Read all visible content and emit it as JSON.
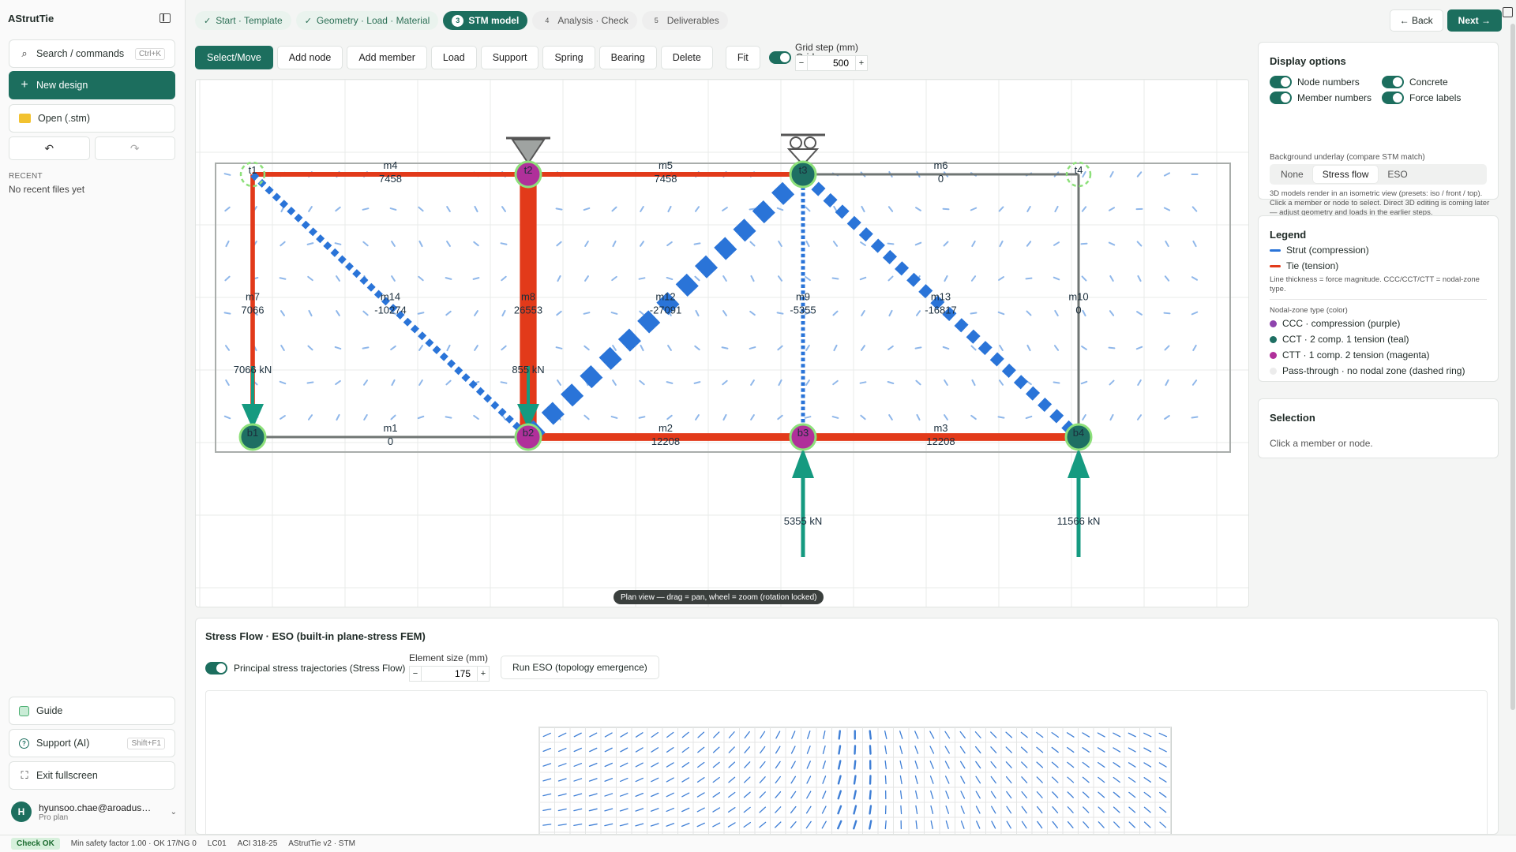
{
  "app": {
    "title": "AStrutTie"
  },
  "sidebar": {
    "search_label": "Search / commands",
    "search_kbd": "Ctrl+K",
    "new_design": "New design",
    "open": "Open (.stm)",
    "recent_heading": "RECENT",
    "recent_empty": "No recent files yet",
    "guide": "Guide",
    "support": "Support (AI)",
    "support_kbd": "Shift+F1",
    "exit_fullscreen": "Exit fullscreen",
    "user_initial": "H",
    "user_email": "hyunsoo.chae@aroadus…",
    "user_plan": "Pro plan"
  },
  "steps": [
    {
      "num": "✓",
      "label": "Start · Template",
      "state": "done"
    },
    {
      "num": "✓",
      "label": "Geometry · Load · Material",
      "state": "done"
    },
    {
      "num": "3",
      "label": "STM model",
      "state": "active"
    },
    {
      "num": "4",
      "label": "Analysis · Check",
      "state": "todo"
    },
    {
      "num": "5",
      "label": "Deliverables",
      "state": "todo"
    }
  ],
  "nav": {
    "back": "← Back",
    "next": "Next →"
  },
  "toolbar": {
    "tools": [
      "Select/Move",
      "Add node",
      "Add member",
      "Load",
      "Support",
      "Spring",
      "Bearing",
      "Delete"
    ],
    "fit": "Fit",
    "grid": "Grid",
    "grid_step_label": "Grid step (mm)",
    "grid_step_value": "500"
  },
  "canvas": {
    "hint": "Plan view — drag = pan, wheel = zoom (rotation locked)",
    "nodes": [
      {
        "id": "t1",
        "zone": "pass"
      },
      {
        "id": "t2",
        "zone": "CTT"
      },
      {
        "id": "t3",
        "zone": "CCT"
      },
      {
        "id": "t4",
        "zone": "pass"
      },
      {
        "id": "b1",
        "zone": "CCT"
      },
      {
        "id": "b2",
        "zone": "CTT"
      },
      {
        "id": "b3",
        "zone": "CTT"
      },
      {
        "id": "b4",
        "zone": "CCT"
      }
    ],
    "members": [
      {
        "id": "m1",
        "from": "b1",
        "to": "b2",
        "force": "0",
        "kind": "zero"
      },
      {
        "id": "m2",
        "from": "b2",
        "to": "b3",
        "force": "12208",
        "kind": "tie"
      },
      {
        "id": "m3",
        "from": "b3",
        "to": "b4",
        "force": "12208",
        "kind": "tie"
      },
      {
        "id": "m4",
        "from": "t1",
        "to": "t2",
        "force": "7458",
        "kind": "tie"
      },
      {
        "id": "m5",
        "from": "t2",
        "to": "t3",
        "force": "7458",
        "kind": "tie"
      },
      {
        "id": "m6",
        "from": "t3",
        "to": "t4",
        "force": "0",
        "kind": "zero"
      },
      {
        "id": "m7",
        "from": "t1",
        "to": "b1",
        "force": "7066",
        "kind": "tie"
      },
      {
        "id": "m8",
        "from": "t2",
        "to": "b2",
        "force": "26553",
        "kind": "tie"
      },
      {
        "id": "m9",
        "from": "t3",
        "to": "b3",
        "force": "-5355",
        "kind": "strut"
      },
      {
        "id": "m10",
        "from": "t4",
        "to": "b4",
        "force": "0",
        "kind": "zero"
      },
      {
        "id": "m12",
        "from": "b2",
        "to": "t3",
        "force": "-27091",
        "kind": "strut"
      },
      {
        "id": "m13",
        "from": "t3",
        "to": "b4",
        "force": "-16817",
        "kind": "strut"
      },
      {
        "id": "m14",
        "from": "t1",
        "to": "b2",
        "force": "-10274",
        "kind": "strut"
      }
    ],
    "loads": [
      {
        "node": "b1",
        "label": "7066 kN",
        "dir": "down"
      },
      {
        "node": "b2",
        "label": "855 kN",
        "dir": "down"
      },
      {
        "node": "b3",
        "label": "5355 kN",
        "dir": "up"
      },
      {
        "node": "b4",
        "label": "11566 kN",
        "dir": "up"
      }
    ],
    "supports": [
      {
        "node": "t2",
        "type": "pin"
      },
      {
        "node": "t3",
        "type": "roller"
      }
    ]
  },
  "display_options": {
    "title": "Display options",
    "options": [
      {
        "label": "Node numbers",
        "on": true
      },
      {
        "label": "Concrete",
        "on": true
      },
      {
        "label": "Member numbers",
        "on": true
      },
      {
        "label": "Force labels",
        "on": true
      }
    ],
    "underlay_label": "Background underlay (compare STM match)",
    "underlay_options": [
      "None",
      "Stress flow",
      "ESO"
    ],
    "underlay_selected": "Stress flow",
    "note": "3D models render in an isometric view (presets: iso / front / top). Click a member or node to select. Direct 3D editing is coming later — adjust geometry and loads in the earlier steps."
  },
  "legend": {
    "title": "Legend",
    "strut": "Strut (compression)",
    "tie": "Tie (tension)",
    "thickness_note": "Line thickness = force magnitude. CCC/CCT/CTT = nodal-zone type.",
    "zone_heading": "Nodal-zone type (color)",
    "zones": [
      {
        "label": "CCC · compression (purple)",
        "color": "#8e44ad"
      },
      {
        "label": "CCT · 2 comp. 1 tension (teal)",
        "color": "#1e6f63"
      },
      {
        "label": "CTT · 1 comp. 2 tension (magenta)",
        "color": "#b0309a"
      },
      {
        "label": "Pass-through · no nodal zone (dashed ring)",
        "color": "#e6e6e6"
      }
    ],
    "colors": {
      "strut": "#2a74d8",
      "tie": "#e23a1a",
      "zero": "#6f7573"
    }
  },
  "selection": {
    "title": "Selection",
    "hint": "Click a member or node."
  },
  "stress_flow": {
    "title": "Stress Flow · ESO (built-in plane-stress FEM)",
    "toggle_label": "Principal stress trajectories (Stress Flow)",
    "element_size_label": "Element size (mm)",
    "element_size_value": "175",
    "run_label": "Run ESO (topology emergence)"
  },
  "status": {
    "badge": "Check OK",
    "safety": "Min safety factor 1.00 · OK 17/NG 0",
    "load_case": "LC01",
    "code": "ACI 318-25",
    "version": "AStrutTie v2 · STM"
  }
}
